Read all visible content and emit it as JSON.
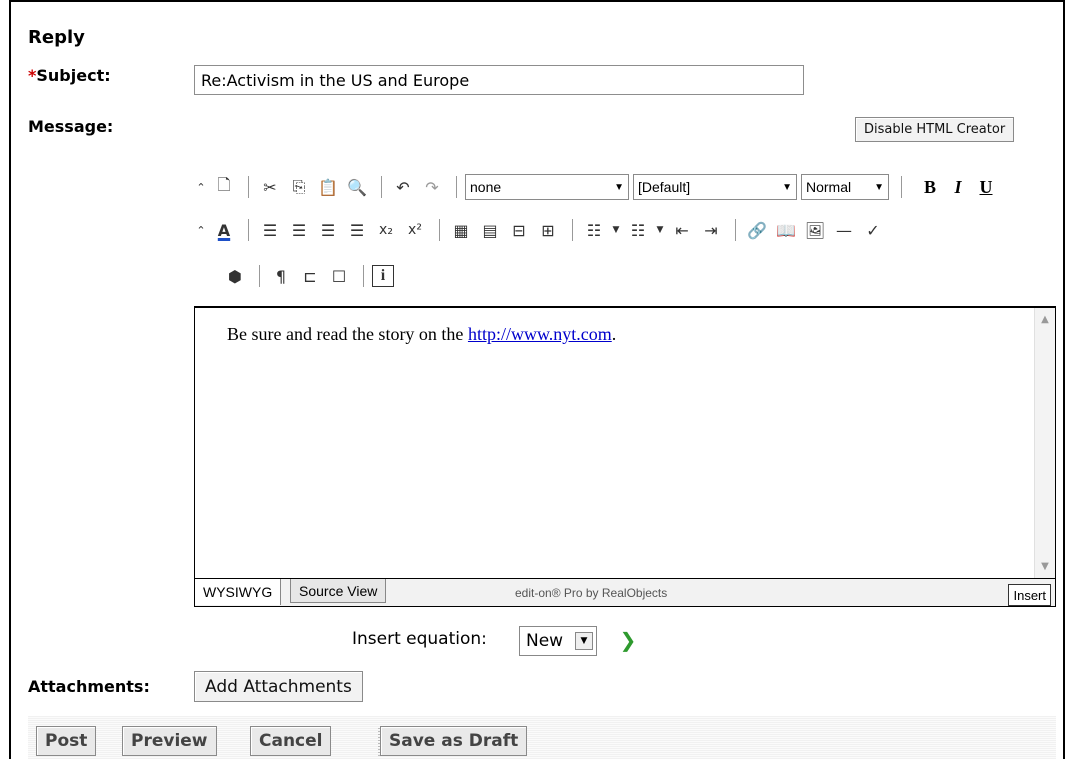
{
  "form": {
    "heading": "Reply",
    "required_marker": "*",
    "subject_label": "Subject:",
    "subject_value": "Re:Activism in the US and Europe",
    "message_label": "Message:",
    "disable_html_button": "Disable HTML Creator"
  },
  "toolbar": {
    "style_select": "none",
    "font_select": "[Default]",
    "size_select": "Normal",
    "bold": "B",
    "italic": "I",
    "underline": "U",
    "info": "i"
  },
  "editor": {
    "content_prefix": "Be sure and read the story on the ",
    "link_text": "http://www.nyt.com",
    "content_suffix": ".",
    "tab_wysiwyg": "WYSIWYG",
    "tab_source": "Source View",
    "credit": "edit-on® Pro by RealObjects",
    "insert_mode": "Insert"
  },
  "equation": {
    "label": "Insert equation:",
    "selected": "New"
  },
  "attachments": {
    "label": "Attachments:",
    "button": "Add Attachments"
  },
  "actions": {
    "post": "Post",
    "preview": "Preview",
    "cancel": "Cancel",
    "save_draft": "Save as Draft"
  }
}
